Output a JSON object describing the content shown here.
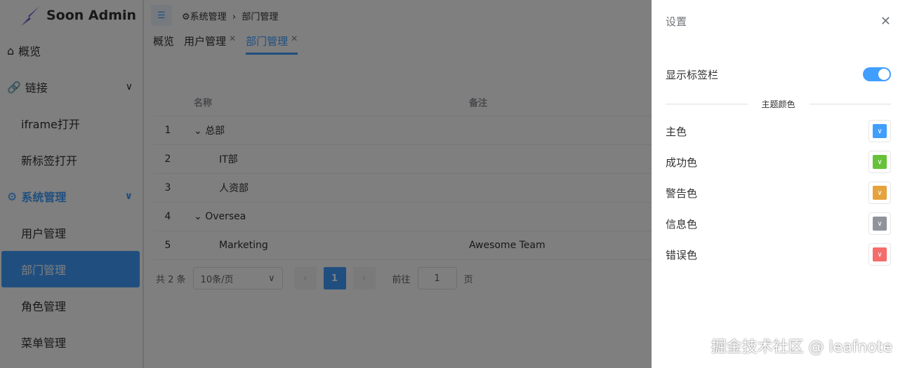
{
  "app": {
    "title": "Soon Admin"
  },
  "sidebar": {
    "items": [
      {
        "label": "概览",
        "icon": "home-icon"
      },
      {
        "label": "链接",
        "icon": "link-icon"
      },
      {
        "label": "iframe打开"
      },
      {
        "label": "新标签打开"
      },
      {
        "label": "系统管理",
        "icon": "gear-icon"
      },
      {
        "label": "用户管理"
      },
      {
        "label": "部门管理"
      },
      {
        "label": "角色管理"
      },
      {
        "label": "菜单管理"
      }
    ]
  },
  "header": {
    "breadcrumb": [
      "系统管理",
      "部门管理"
    ]
  },
  "tabs": [
    {
      "label": "概览"
    },
    {
      "label": "用户管理"
    },
    {
      "label": "部门管理"
    }
  ],
  "table": {
    "headers": [
      "名称",
      "备注"
    ],
    "rows": [
      {
        "no": "1",
        "name": "总部",
        "note": ""
      },
      {
        "no": "2",
        "name": "IT部",
        "note": ""
      },
      {
        "no": "3",
        "name": "人资部",
        "note": ""
      },
      {
        "no": "4",
        "name": "Oversea",
        "note": ""
      },
      {
        "no": "5",
        "name": "Marketing",
        "note": "Awesome Team"
      }
    ]
  },
  "pager": {
    "total": "共 2 条",
    "size": "10条/页",
    "page": "1",
    "goto": "前往",
    "goto_value": "1",
    "unit": "页"
  },
  "drawer": {
    "title": "设置",
    "show_tags": "显示标签栏",
    "show_tags_on": true,
    "theme_title": "主题颜色",
    "colors": [
      {
        "label": "主色",
        "value": "#409eff"
      },
      {
        "label": "成功色",
        "value": "#67c23a"
      },
      {
        "label": "警告色",
        "value": "#e6a23c"
      },
      {
        "label": "信息色",
        "value": "#909399"
      },
      {
        "label": "错误色",
        "value": "#f56c6c"
      }
    ]
  },
  "watermark": "掘金技术社区 @ leafnote"
}
